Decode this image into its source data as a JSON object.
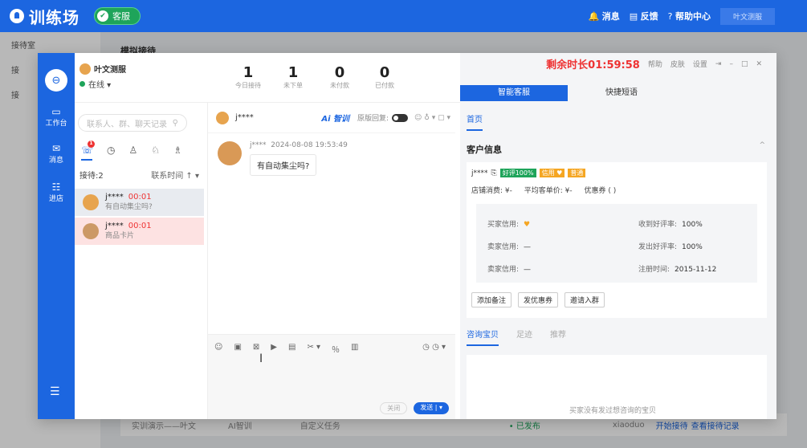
{
  "topbar": {
    "brand": "训练场",
    "cs_label": "客服",
    "messages": "消息",
    "feedback": "反馈",
    "help": "帮助中心",
    "user": "叶文测服"
  },
  "background": {
    "sidebar_items": [
      "接待室",
      "接",
      "接"
    ],
    "page_title": "模拟接待",
    "row": [
      "实训演示——叶文",
      "AI智训",
      "自定义任务",
      "• 已发布",
      "xiaoduo",
      "开始接待",
      "查看接待记录"
    ]
  },
  "rail": {
    "avatar": "⊖",
    "items": [
      {
        "icon": "▭",
        "label": "工作台"
      },
      {
        "icon": "✉",
        "label": "消息"
      },
      {
        "icon": "☷",
        "label": "进店"
      }
    ],
    "menu": "☰"
  },
  "agent": {
    "name": "叶文测服",
    "status": "在线 ▾"
  },
  "stats": [
    {
      "value": "1",
      "label": "今日接待"
    },
    {
      "value": "1",
      "label": "未下单"
    },
    {
      "value": "0",
      "label": "未付款"
    },
    {
      "value": "0",
      "label": "已付款"
    }
  ],
  "left": {
    "search_placeholder": "联系人、群、聊天记录",
    "search_icon": "⚲",
    "badge": "1",
    "sort_label": "接待:2",
    "sort_by": "联系时间 ↑ ▾",
    "conversations": [
      {
        "name": "j****",
        "time": "00:01",
        "preview": "有自动集尘吗?"
      },
      {
        "name": "j****",
        "time": "00:01",
        "preview": "商品卡片"
      }
    ]
  },
  "chat": {
    "contact": "j****",
    "ai_label": "Ai 智训",
    "orig_reply": "原版回复:",
    "tools": "☺  ♁ ▾  ▢ ▾",
    "msg_sender": "j****",
    "msg_time": "2024-08-08 19:53:49",
    "msg_text": "有自动集尘吗?",
    "composer_tools": [
      "☺",
      "▣",
      "⊠",
      "▶",
      "▤",
      "✂ ▾",
      "％",
      "▥"
    ],
    "composer_right": "◷   ◷ ▾",
    "close_btn": "关闭",
    "send_btn": "发送 | ▾"
  },
  "right": {
    "timer": "剩余时长01:59:58",
    "timer_links": [
      "帮助",
      "皮肤",
      "设置",
      "⇥",
      "–",
      "□",
      "✕"
    ],
    "tabs": [
      "智能客服",
      "快捷短语"
    ],
    "home_tab": "首页",
    "section_title": "客户信息",
    "customer_id": "j****",
    "tag_good": "好评100%",
    "tag_credit": "信用 ♥",
    "tag_normal": "普通",
    "shop_spend": "店铺消费: ¥-",
    "avg_price": "平均客单价: ¥-",
    "coupon": "优惠券 ( )",
    "kv": [
      {
        "k": "买家信用:",
        "v": "♥"
      },
      {
        "k": "收到好评率:",
        "v": "100%"
      },
      {
        "k": "卖家信用:",
        "v": "—"
      },
      {
        "k": "发出好评率:",
        "v": "100%"
      },
      {
        "k": "卖家信用:",
        "v": "—"
      },
      {
        "k": "注册时间:",
        "v": "2015-11-12"
      }
    ],
    "buttons": [
      "添加备注",
      "发优惠券",
      "邀请入群"
    ],
    "subtabs": [
      "咨询宝贝",
      "足迹",
      "推荐"
    ],
    "empty_text": "买家没有发过想咨询的宝贝"
  }
}
